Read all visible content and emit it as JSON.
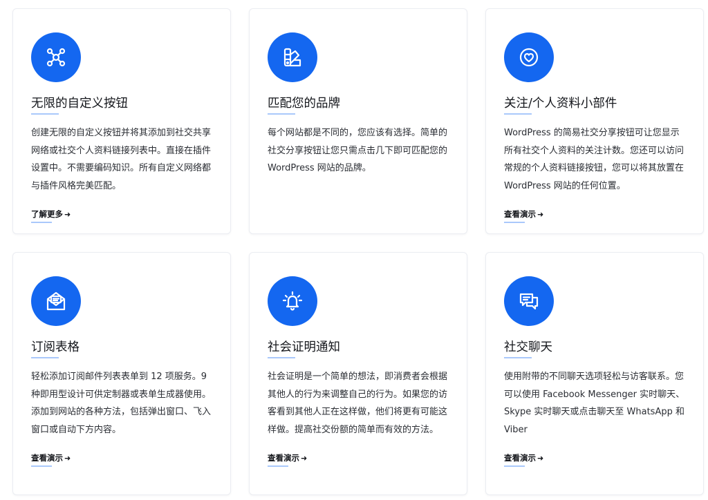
{
  "colors": {
    "accent": "#1467f0",
    "underline": "#a9c8fb"
  },
  "cards": [
    {
      "icon": "nodes-icon",
      "title": "无限的自定义按钮",
      "description": "创建无限的自定义按钮并将其添加到社交共享网络或社交个人资料链接列表中。直接在插件设置中。不需要编码知识。所有自定义网络都与插件风格完美匹配。",
      "link": "了解更多"
    },
    {
      "icon": "palette-icon",
      "title": "匹配您的品牌",
      "description": "每个网站都是不同的，您应该有选择。简单的社交分享按钮让您只需点击几下即可匹配您的 WordPress 网站的品牌。",
      "link": ""
    },
    {
      "icon": "heart-icon",
      "title": "关注/个人资料小部件",
      "description": "WordPress 的简易社交分享按钮可让您显示所有社交个人资料的关注计数。您还可以访问常规的个人资料链接按钮，您可以将其放置在 WordPress 网站的任何位置。",
      "link": "查看演示"
    },
    {
      "icon": "envelope-icon",
      "title": "订阅表格",
      "description": "轻松添加订阅邮件列表表单到 12 项服务。9 种即用型设计可供定制器或表单生成器使用。添加到网站的各种方法，包括弹出窗口、飞入窗口或自动下方内容。",
      "link": "查看演示"
    },
    {
      "icon": "bell-icon",
      "title": "社会证明通知",
      "description": "社会证明是一个简单的想法，即消费者会根据其他人的行为来调整自己的行为。如果您的访客看到其他人正在这样做，他们将更有可能这样做。提高社交份额的简单而有效的方法。",
      "link": "查看演示"
    },
    {
      "icon": "chat-bubbles-icon",
      "title": "社交聊天",
      "description": "使用附带的不同聊天选项轻松与访客联系。您可以使用 Facebook Messenger 实时聊天、Skype 实时聊天或点击聊天至 WhatsApp 和 Viber",
      "link": "查看演示"
    }
  ]
}
